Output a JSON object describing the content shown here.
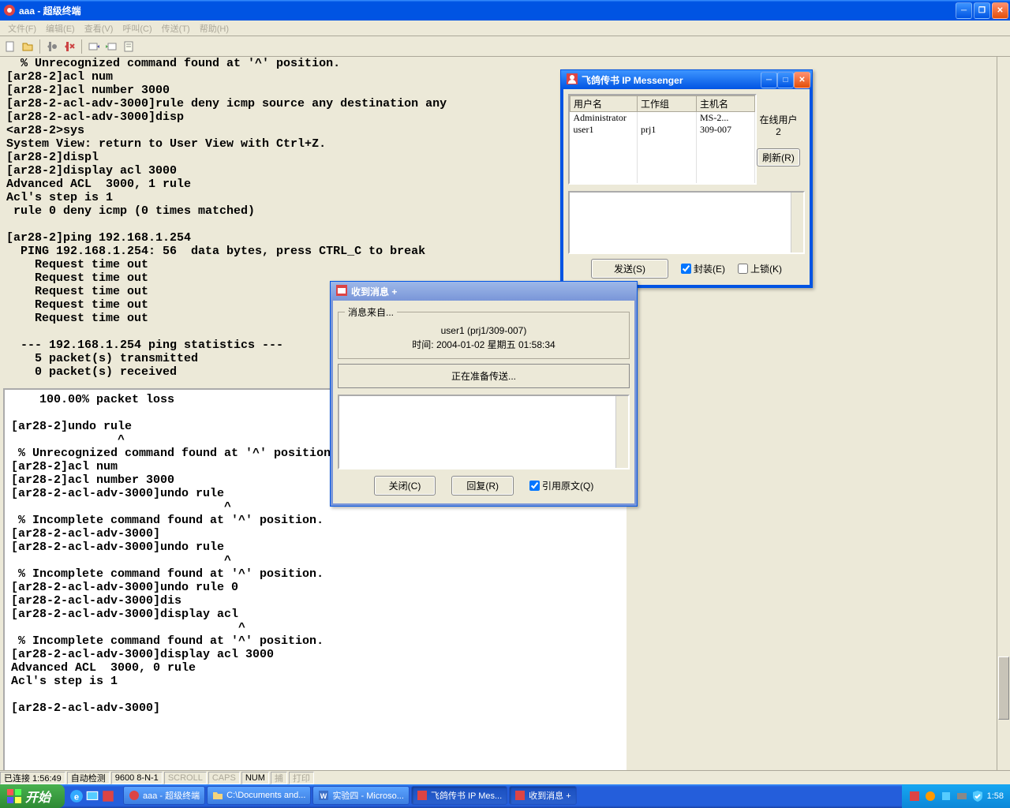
{
  "window": {
    "title": "aaa - 超级终端"
  },
  "menu": {
    "file": "文件(F)",
    "edit": "编辑(E)",
    "view": "查看(V)",
    "call": "呼叫(C)",
    "transfer": "传送(T)",
    "help": "帮助(H)"
  },
  "terminal_upper": "  % Unrecognized command found at '^' position.\n[ar28-2]acl num\n[ar28-2]acl number 3000\n[ar28-2-acl-adv-3000]rule deny icmp source any destination any\n[ar28-2-acl-adv-3000]disp\n<ar28-2>sys\nSystem View: return to User View with Ctrl+Z.\n[ar28-2]displ\n[ar28-2]display acl 3000\nAdvanced ACL  3000, 1 rule\nAcl's step is 1\n rule 0 deny icmp (0 times matched)\n\n[ar28-2]ping 192.168.1.254\n  PING 192.168.1.254: 56  data bytes, press CTRL_C to break\n    Request time out\n    Request time out\n    Request time out\n    Request time out\n    Request time out\n\n  --- 192.168.1.254 ping statistics ---\n    5 packet(s) transmitted\n    0 packet(s) received",
  "terminal_lower": "    100.00% packet loss\n\n[ar28-2]undo rule\n               ^\n % Unrecognized command found at '^' position.\n[ar28-2]acl num\n[ar28-2]acl number 3000\n[ar28-2-acl-adv-3000]undo rule\n                              ^\n % Incomplete command found at '^' position.\n[ar28-2-acl-adv-3000]\n[ar28-2-acl-adv-3000]undo rule\n                              ^\n % Incomplete command found at '^' position.\n[ar28-2-acl-adv-3000]undo rule 0\n[ar28-2-acl-adv-3000]dis\n[ar28-2-acl-adv-3000]display acl\n                                ^\n % Incomplete command found at '^' position.\n[ar28-2-acl-adv-3000]display acl 3000\nAdvanced ACL  3000, 0 rule\nAcl's step is 1\n\n[ar28-2-acl-adv-3000]",
  "status": {
    "connected": "已连接 1:56:49",
    "autodetect": "自动检测",
    "baud": "9600 8-N-1",
    "scroll": "SCROLL",
    "caps": "CAPS",
    "num": "NUM",
    "capture": "捕",
    "print": "打印"
  },
  "ipmsg": {
    "title": "飞鸽传书  IP Messenger",
    "cols": {
      "user": "用户名",
      "group": "工作组",
      "host": "主机名"
    },
    "rows": [
      {
        "user": "Administrator",
        "group": "",
        "host": "MS-2..."
      },
      {
        "user": "user1",
        "group": "prj1",
        "host": "309-007"
      }
    ],
    "online_label": "在线用户",
    "online_count": "2",
    "refresh": "刷新(R)",
    "send": "发送(S)",
    "seal": "封装(E)",
    "lock": "上锁(K)"
  },
  "recv": {
    "title": "收到消息 +",
    "from_label": "消息来自...",
    "from": "user1 (prj1/309-007)",
    "time": "时间: 2004-01-02 星期五 01:58:34",
    "preparing": "正在准备传送...",
    "close": "关闭(C)",
    "reply": "回复(R)",
    "quote": "引用原文(Q)"
  },
  "taskbar": {
    "start": "开始",
    "items": [
      {
        "label": "aaa - 超级终端"
      },
      {
        "label": "C:\\Documents and..."
      },
      {
        "label": "实验四 - Microso..."
      },
      {
        "label": "飞鸽传书  IP Mes..."
      },
      {
        "label": "收到消息 +"
      }
    ],
    "clock": "1:58"
  }
}
